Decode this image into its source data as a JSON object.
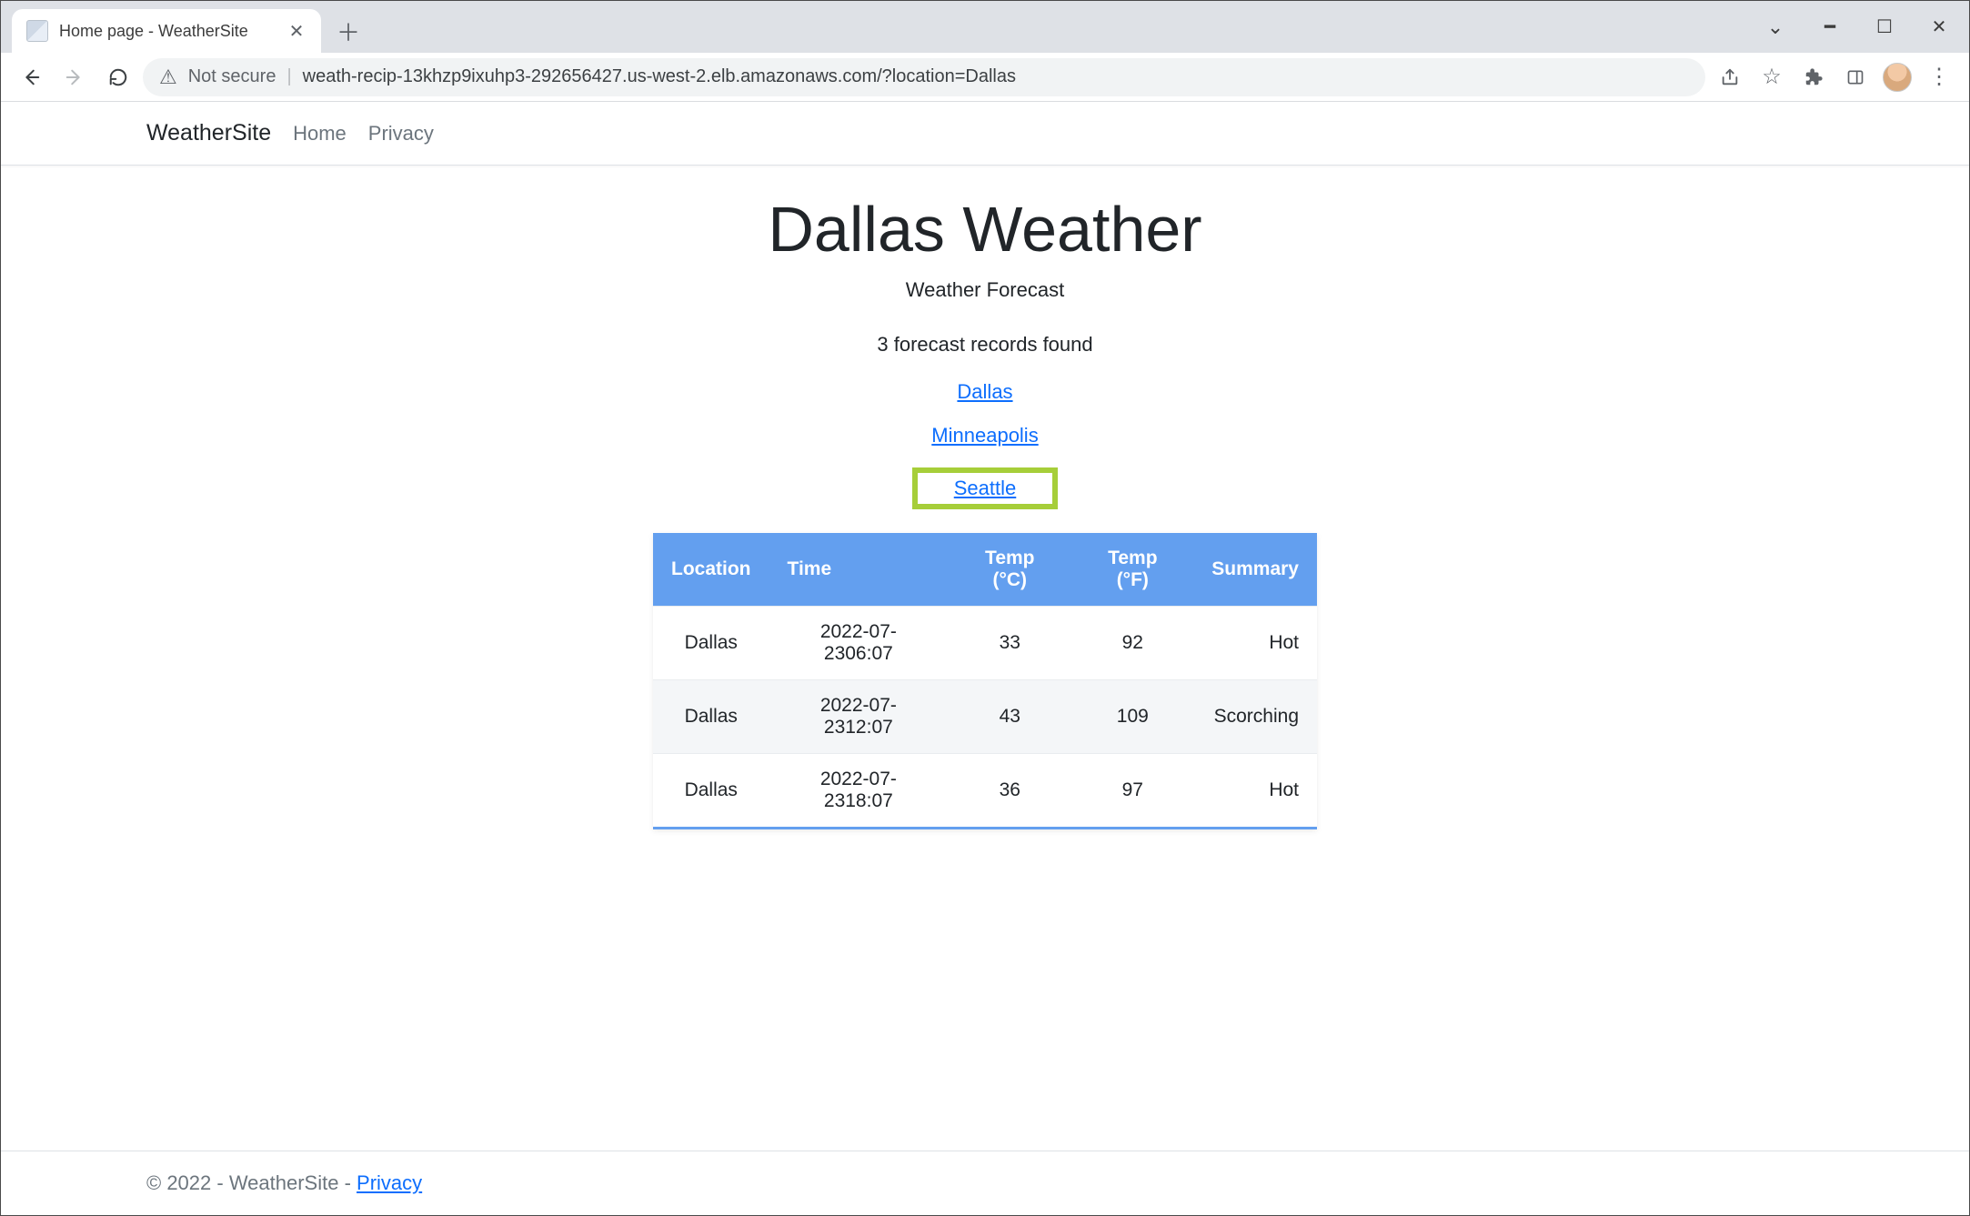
{
  "browser": {
    "tab_title": "Home page - WeatherSite",
    "not_secure_label": "Not secure",
    "url": "weath-recip-13khzp9ixuhp3-292656427.us-west-2.elb.amazonaws.com/?location=Dallas"
  },
  "nav": {
    "brand": "WeatherSite",
    "home": "Home",
    "privacy": "Privacy"
  },
  "page": {
    "title": "Dallas Weather",
    "subtitle": "Weather Forecast",
    "records_found": "3 forecast records found",
    "location_links": {
      "dallas": "Dallas",
      "minneapolis": "Minneapolis",
      "seattle": "Seattle"
    }
  },
  "table": {
    "headers": {
      "location": "Location",
      "time": "Time",
      "temp_c": "Temp (°C)",
      "temp_f": "Temp (°F)",
      "summary": "Summary"
    },
    "rows": [
      {
        "location": "Dallas",
        "time": "2022-07-2306:07",
        "temp_c": "33",
        "temp_f": "92",
        "summary": "Hot"
      },
      {
        "location": "Dallas",
        "time": "2022-07-2312:07",
        "temp_c": "43",
        "temp_f": "109",
        "summary": "Scorching"
      },
      {
        "location": "Dallas",
        "time": "2022-07-2318:07",
        "temp_c": "36",
        "temp_f": "97",
        "summary": "Hot"
      }
    ]
  },
  "footer": {
    "text": "© 2022 - WeatherSite - ",
    "privacy": "Privacy"
  }
}
